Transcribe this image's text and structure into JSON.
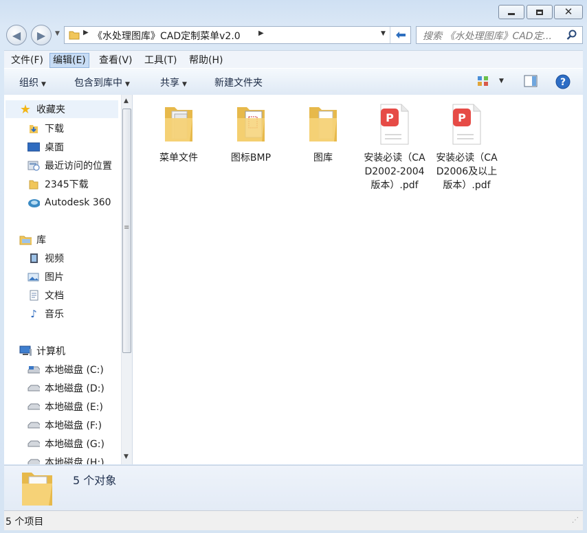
{
  "nav": {
    "address_path": [
      "《水处理图库》CAD定制菜单v2.0"
    ],
    "search_placeholder": "搜索 《水处理图库》CAD定..."
  },
  "menu": {
    "items": [
      {
        "label": "文件(F)"
      },
      {
        "label": "编辑(E)"
      },
      {
        "label": "查看(V)"
      },
      {
        "label": "工具(T)"
      },
      {
        "label": "帮助(H)"
      }
    ]
  },
  "toolbar": {
    "organize": "组织",
    "include_in_library": "包含到库中",
    "share": "共享",
    "new_folder": "新建文件夹"
  },
  "sidebar": {
    "favorites": {
      "label": "收藏夹",
      "items": [
        {
          "label": "下载",
          "icon": "download-folder-icon"
        },
        {
          "label": "桌面",
          "icon": "desktop-icon"
        },
        {
          "label": "最近访问的位置",
          "icon": "recent-places-icon"
        },
        {
          "label": "2345下载",
          "icon": "folder-icon"
        },
        {
          "label": "Autodesk 360",
          "icon": "cloud-icon"
        }
      ]
    },
    "libraries": {
      "label": "库",
      "items": [
        {
          "label": "视频",
          "icon": "video-library-icon"
        },
        {
          "label": "图片",
          "icon": "pictures-library-icon"
        },
        {
          "label": "文档",
          "icon": "documents-library-icon"
        },
        {
          "label": "音乐",
          "icon": "music-library-icon"
        }
      ]
    },
    "computer": {
      "label": "计算机",
      "items": [
        {
          "label": "本地磁盘 (C:)",
          "icon": "system-drive-icon"
        },
        {
          "label": "本地磁盘 (D:)",
          "icon": "drive-icon"
        },
        {
          "label": "本地磁盘 (E:)",
          "icon": "drive-icon"
        },
        {
          "label": "本地磁盘 (F:)",
          "icon": "drive-icon"
        },
        {
          "label": "本地磁盘 (G:)",
          "icon": "drive-icon"
        },
        {
          "label": "本地磁盘 (H:)",
          "icon": "drive-icon"
        }
      ]
    }
  },
  "files": [
    {
      "name": "菜单文件",
      "type": "folder"
    },
    {
      "name": "图标BMP",
      "type": "folder"
    },
    {
      "name": "图库",
      "type": "folder"
    },
    {
      "name": "安装必读（CAD2002-2004版本）.pdf",
      "type": "pdf"
    },
    {
      "name": "安装必读（CAD2006及以上版本）.pdf",
      "type": "pdf"
    }
  ],
  "details": {
    "summary": "5 个对象"
  },
  "status": {
    "text": "5 个项目"
  },
  "colors": {
    "accent": "#3a74c7",
    "pdf_red": "#e64b46",
    "folder_yellow": "#f3c95c"
  }
}
